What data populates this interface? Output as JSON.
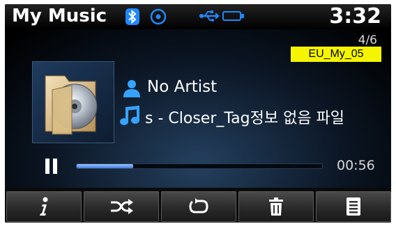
{
  "status_bar": {
    "title": "My Music",
    "clock": "3:32",
    "icons": [
      "bluetooth-icon",
      "disc-icon",
      "usb-icon",
      "battery-icon"
    ],
    "accent_color": "#1e88ff"
  },
  "now_playing": {
    "track_counter": "4/6",
    "source_label": "EU_My_05",
    "artist": "No Artist",
    "title": "s - Closer_Tag정보 없음 파일",
    "elapsed": "00:56",
    "progress_fraction": 0.23,
    "state": "playing"
  },
  "controls": [
    {
      "name": "info-button",
      "icon": "info-icon"
    },
    {
      "name": "shuffle-button",
      "icon": "shuffle-icon"
    },
    {
      "name": "repeat-button",
      "icon": "repeat-icon"
    },
    {
      "name": "delete-button",
      "icon": "trash-icon"
    },
    {
      "name": "list-button",
      "icon": "list-icon"
    }
  ]
}
